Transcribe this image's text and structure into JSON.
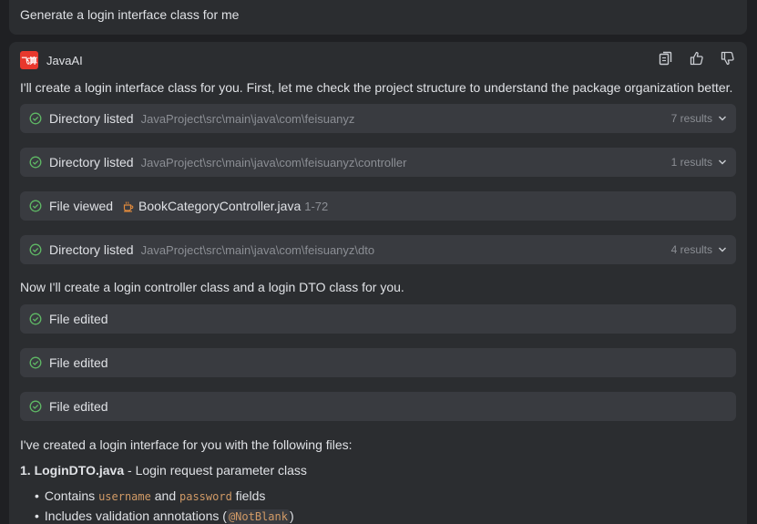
{
  "user_message": "Generate a login interface class for me",
  "assistant": {
    "logo_text": "飞算",
    "name": "JavaAI",
    "actions": [
      "copy-icon",
      "thumbs-up-icon",
      "thumbs-down-icon"
    ],
    "intro": "I'll create a login interface class for you. First, let me check the project structure to understand the package organization better.",
    "steps": [
      {
        "label": "Directory listed",
        "path": "JavaProject\\src\\main\\java\\com\\feisuanyz",
        "count": "7 results"
      },
      {
        "label": "Directory listed",
        "path": "JavaProject\\src\\main\\java\\com\\feisuanyz\\controller",
        "count": "1 results"
      },
      {
        "label": "File viewed",
        "file": "BookCategoryController.java",
        "range": "1-72"
      },
      {
        "label": "Directory listed",
        "path": "JavaProject\\src\\main\\java\\com\\feisuanyz\\dto",
        "count": "4 results"
      }
    ],
    "middle_text": "Now I'll create a login controller class and a login DTO class for you.",
    "edits": [
      {
        "label": "File edited"
      },
      {
        "label": "File edited"
      },
      {
        "label": "File edited"
      }
    ],
    "summary": "I've created a login interface for you with the following files:",
    "item1": {
      "number": "1.",
      "name": "LoginDTO.java",
      "desc": " - Login request parameter class"
    },
    "bullet1": {
      "pre": "Contains ",
      "code1": "username",
      "mid": " and ",
      "code2": "password",
      "post": " fields"
    },
    "bullet2": {
      "pre": "Includes validation annotations (",
      "code": "@NotBlank",
      "post": ")"
    }
  },
  "colors": {
    "check": "#5fb865",
    "file_icon": "#e08a3c",
    "logo": "#e8382d"
  }
}
